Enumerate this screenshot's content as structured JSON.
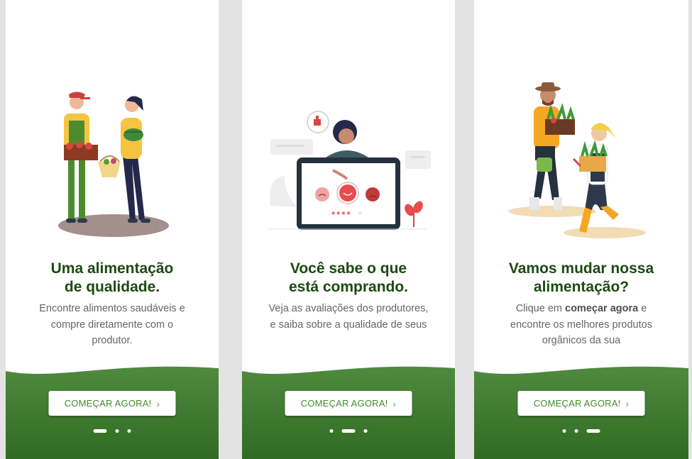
{
  "screens": [
    {
      "title_line1": "Uma alimentação",
      "title_line2": "de qualidade.",
      "description": "Encontre alimentos saudáveis e compre diretamente com o produtor.",
      "button_label": "COMEÇAR AGORA!",
      "active_dot_index": 0
    },
    {
      "title_line1": "Você sabe o que",
      "title_line2": "está comprando.",
      "description": "Veja as avaliações dos produtores, e saiba sobre a qualidade de seus",
      "button_label": "COMEÇAR AGORA!",
      "active_dot_index": 1
    },
    {
      "title_line1": "Vamos mudar nossa",
      "title_line2": "alimentação?",
      "description_prefix": "Clique em ",
      "description_bold": "começar agora",
      "description_suffix": " e encontre os melhores produtos orgânicos da sua",
      "button_label": "COMEÇAR AGORA!",
      "active_dot_index": 2
    }
  ],
  "icons": {
    "button_chevron": "chevron-right-icon"
  },
  "colors": {
    "title": "#1c4a12",
    "green_top": "#4f8a3f",
    "green_bottom": "#2f6b22",
    "button_text": "#3f8a2a",
    "page_background": "#e3e3e3"
  }
}
